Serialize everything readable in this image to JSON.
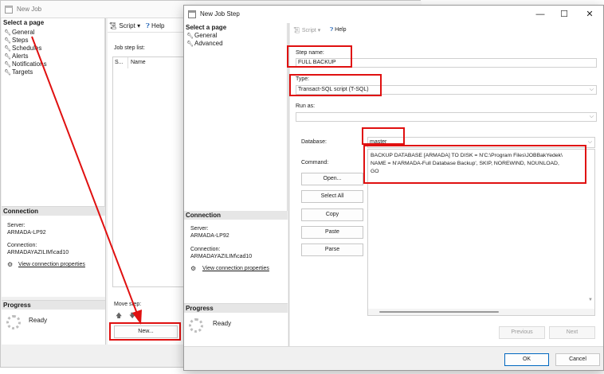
{
  "background_window": {
    "title": "New Job",
    "select_page_header": "Select a page",
    "pages": [
      "General",
      "Steps",
      "Schedules",
      "Alerts",
      "Notifications",
      "Targets"
    ],
    "toolbar": {
      "script_label": "Script",
      "help_label": "Help"
    },
    "job_step_list_label": "Job step list:",
    "columns": [
      "S...",
      "Name"
    ],
    "connection": {
      "header": "Connection",
      "server_label": "Server:",
      "server_value": "ARMADA-LP92",
      "connection_label": "Connection:",
      "connection_value": "ARMADAYAZILIM\\cad10",
      "view_link": "View connection properties"
    },
    "progress": {
      "header": "Progress",
      "status": "Ready"
    },
    "move_step_label": "Move step:",
    "new_button": "New..."
  },
  "dialog": {
    "title": "New Job Step",
    "select_page_header": "Select a page",
    "pages": [
      "General",
      "Advanced"
    ],
    "toolbar": {
      "script_label": "Script",
      "help_label": "Help"
    },
    "step_name_label": "Step name:",
    "step_name_value": "FULL BACKUP",
    "type_label": "Type:",
    "type_value": "Transact-SQL script (T-SQL)",
    "run_as_label": "Run as:",
    "run_as_value": "",
    "database_label": "Database:",
    "database_value": "master",
    "command_label": "Command:",
    "command_lines": [
      "BACKUP DATABASE [ARMADA] TO DISK = N'C:\\Program Files\\JOBBakYedek\\",
      "NAME = N'ARMADA-Full Database Backup', SKIP, NOREWIND, NOUNLOAD,",
      "GO"
    ],
    "side_buttons": [
      "Open...",
      "Select All",
      "Copy",
      "Paste",
      "Parse"
    ],
    "connection": {
      "header": "Connection",
      "server_label": "Server:",
      "server_value": "ARMADA-LP92",
      "connection_label": "Connection:",
      "connection_value": "ARMADAYAZILIM\\cad10",
      "view_link": "View connection properties"
    },
    "progress": {
      "header": "Progress",
      "status": "Ready"
    },
    "previous_button": "Previous",
    "next_button": "Next",
    "ok_button": "OK",
    "cancel_button": "Cancel"
  },
  "annotation_color": "#e01010"
}
